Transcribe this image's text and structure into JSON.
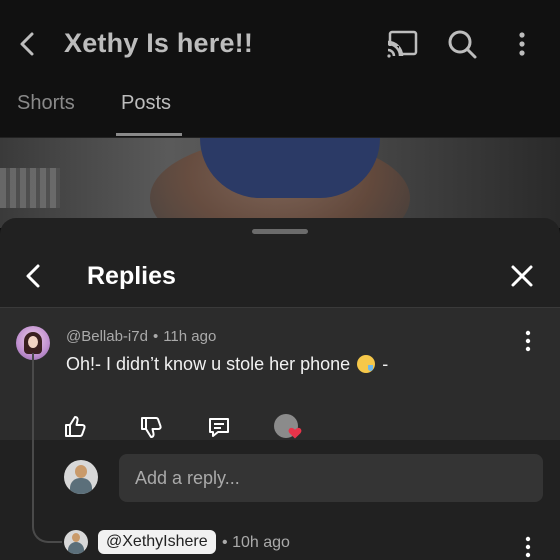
{
  "appbar": {
    "title": "Xethy Is here!!"
  },
  "tabs": [
    {
      "label": "Shorts",
      "active": false
    },
    {
      "label": "Posts",
      "active": true
    }
  ],
  "sheet": {
    "title": "Replies"
  },
  "comment": {
    "author": "@Bellab-i7d",
    "separator": "•",
    "time": "11h ago",
    "text_before_emoji": "Oh!- I didn’t know u stole her phone",
    "emoji": "crying-face-emoji",
    "text_after_emoji": "-"
  },
  "reply_box": {
    "placeholder": "Add a reply..."
  },
  "reply": {
    "author": "@XethyIshere",
    "separator": "•",
    "time": "10h ago"
  },
  "colors": {
    "heart": "#e8344a",
    "sheet_bg": "#212121",
    "comment_bg": "#2c2c2c"
  }
}
